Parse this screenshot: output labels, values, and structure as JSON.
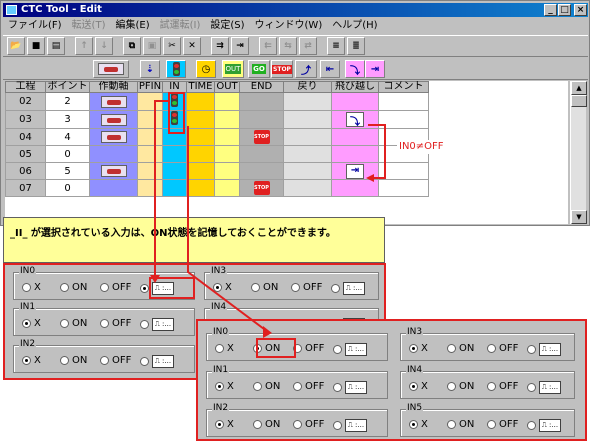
{
  "window": {
    "title": "CTC Tool - Edit",
    "controls": [
      "_",
      "□",
      "×"
    ]
  },
  "menu": [
    {
      "label": "ファイル(F)",
      "disabled": false
    },
    {
      "label": "転送(T)",
      "disabled": true
    },
    {
      "label": "編集(E)",
      "disabled": false
    },
    {
      "label": "試運転(I)",
      "disabled": true
    },
    {
      "label": "設定(S)",
      "disabled": false
    },
    {
      "label": "ウィンドウ(W)",
      "disabled": false
    },
    {
      "label": "ヘルプ(H)",
      "disabled": false
    }
  ],
  "toolbar_icons": [
    "open-icon",
    "save-icon",
    "print-icon",
    "move-up-icon",
    "move-down-icon",
    "copy-icon",
    "paste-icon",
    "cut-icon",
    "delete-icon",
    "insert-row-icon",
    "append-row-icon",
    "disabled-icon-1",
    "disabled-icon-2",
    "disabled-icon-3",
    "align-icon-1",
    "align-icon-2"
  ],
  "icon_row": {
    "labels": [
      "GO",
      "STOP",
      "OUT"
    ]
  },
  "table": {
    "headers": [
      "工程",
      "ポイント",
      "作動軸",
      "PFIN",
      "IN",
      "TIME",
      "OUT",
      "END",
      "戻り",
      "飛び越し",
      "コメント"
    ],
    "rows": [
      {
        "step": "02",
        "point": "2",
        "act": true,
        "in": true,
        "end": false,
        "jump": ""
      },
      {
        "step": "03",
        "point": "3",
        "act": true,
        "in": true,
        "end": false,
        "jump": "start"
      },
      {
        "step": "04",
        "point": "4",
        "act": true,
        "in": false,
        "end": true,
        "jump": ""
      },
      {
        "step": "05",
        "point": "0",
        "act": false,
        "in": false,
        "end": false,
        "jump": ""
      },
      {
        "step": "06",
        "point": "5",
        "act": true,
        "in": false,
        "end": false,
        "jump": "end"
      },
      {
        "step": "07",
        "point": "0",
        "act": false,
        "in": false,
        "end": true,
        "jump": ""
      }
    ]
  },
  "annotation": {
    "jump_label": "IN0≠OFF"
  },
  "note": {
    "text": "_II_ が選択されている入力は、ON状態を記憶しておくことができます。"
  },
  "dialog1": {
    "groups": [
      {
        "name": "IN0",
        "selected": "pulse"
      },
      {
        "name": "IN3",
        "selected": "X"
      },
      {
        "name": "IN1",
        "selected": "X"
      },
      {
        "name": "IN4",
        "selected": "X"
      },
      {
        "name": "IN2",
        "selected": "X"
      }
    ]
  },
  "dialog2": {
    "groups": [
      {
        "name": "IN0",
        "selected": "ON"
      },
      {
        "name": "IN3",
        "selected": "X"
      },
      {
        "name": "IN1",
        "selected": "X"
      },
      {
        "name": "IN4",
        "selected": "X"
      },
      {
        "name": "IN2",
        "selected": "X"
      },
      {
        "name": "IN5",
        "selected": "X"
      }
    ]
  },
  "options": {
    "x": "X",
    "on": "ON",
    "off": "OFF",
    "pulse": "⎍ :..."
  },
  "colors": {
    "pfin": "#ffe8a0",
    "in": "#00c8ff",
    "time": "#ffd400",
    "out": "#ffff80",
    "end": "#b0b0b0",
    "ret": "#e0e0e0",
    "jump": "#ff9cff",
    "act": "#9090ff",
    "highlight": "#e02020"
  }
}
